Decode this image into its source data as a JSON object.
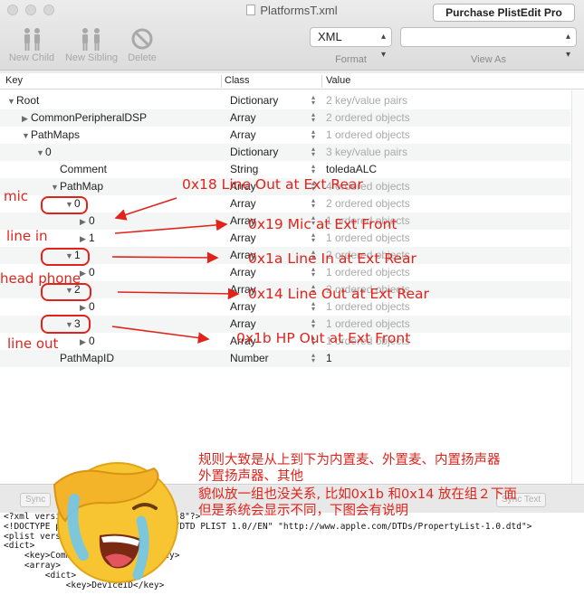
{
  "window": {
    "title": "PlatformsT.xml",
    "purchase_label": "Purchase PlistEdit Pro"
  },
  "toolbar": {
    "new_child": "New Child",
    "new_sibling": "New Sibling",
    "delete": "Delete",
    "format_value": "XML",
    "format_caption": "Format",
    "view_as_value": "",
    "view_as_caption": "View As"
  },
  "table": {
    "headers": {
      "key": "Key",
      "class": "Class",
      "value": "Value"
    },
    "rows": [
      {
        "key": "Root",
        "class": "Dictionary",
        "value": "2 key/value pairs"
      },
      {
        "key": "CommonPeripheralDSP",
        "class": "Array",
        "value": "2 ordered objects"
      },
      {
        "key": "PathMaps",
        "class": "Array",
        "value": "1 ordered objects"
      },
      {
        "key": "0",
        "class": "Dictionary",
        "value": "3 key/value pairs"
      },
      {
        "key": "Comment",
        "class": "String",
        "value": "toledaALC"
      },
      {
        "key": "PathMap",
        "class": "Array",
        "value": "4 ordered objects"
      },
      {
        "key": "0",
        "class": "Array",
        "value": "2 ordered objects"
      },
      {
        "key": "0",
        "class": "Array",
        "value": "1 ordered objects"
      },
      {
        "key": "1",
        "class": "Array",
        "value": "1 ordered objects"
      },
      {
        "key": "1",
        "class": "Array",
        "value": "2 ordered objects"
      },
      {
        "key": "0",
        "class": "Array",
        "value": "1 ordered objects"
      },
      {
        "key": "2",
        "class": "Array",
        "value": "2 ordered objects"
      },
      {
        "key": "0",
        "class": "Array",
        "value": "1 ordered objects"
      },
      {
        "key": "3",
        "class": "Array",
        "value": "1 ordered objects"
      },
      {
        "key": "0",
        "class": "Array",
        "value": "1 ordered objects"
      },
      {
        "key": "PathMapID",
        "class": "Number",
        "value": "1"
      }
    ]
  },
  "bottom": {
    "sync_left": "Sync",
    "sync_text": "Sync Text",
    "xml_lines": [
      "<?xml version=\"1.0\" encoding=\"UTF-8\"?>",
      "<!DOCTYPE plist PUBLIC \"-//Apple//DTD PLIST 1.0//EN\" \"http://www.apple.com/DTDs/PropertyList-1.0.dtd\">",
      "<plist version=\"1.0\">",
      "<dict>",
      "    <key>CommonPeripheralDSP</key>",
      "    <array>",
      "        <dict>",
      "            <key>DeviceID</key>"
    ]
  },
  "annotations": {
    "line_out_rear_1": "0x18 Line Out at Ext Rear",
    "mic_front": "0x19 Mic at Ext Front",
    "line_in_rear": "0x1a Line In at Ext Rear",
    "line_out_rear_2": "0x14 Line Out at Ext Rear",
    "hp_front": "0x1b HP Out at Ext Front",
    "label_mic": "mic",
    "label_line_in": "line in",
    "label_head_phone": "head phone",
    "label_line_out": "line out",
    "note_lines": [
      "规则大致是从上到下为内置麦、外置麦、内置扬声器",
      "外置扬声器、其他",
      "貌似放一组也没关系, 比如0x1b 和0x14 放在组２下面",
      "但是系统会显示不同，下图会有说明"
    ]
  },
  "colors": {
    "annotation": "#e0241c",
    "emoji": "#f7c531"
  }
}
